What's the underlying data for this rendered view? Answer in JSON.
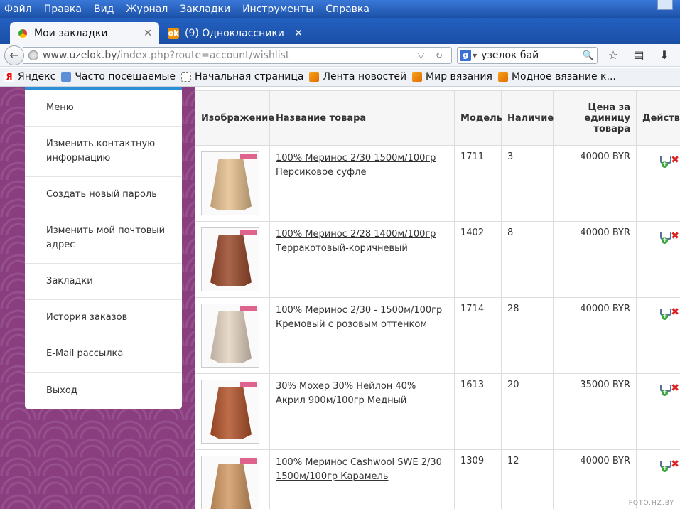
{
  "menubar": {
    "items": [
      "Файл",
      "Правка",
      "Вид",
      "Журнал",
      "Закладки",
      "Инструменты",
      "Справка"
    ]
  },
  "tabs": [
    {
      "label": "Мои закладки",
      "icon": "site-favicon",
      "active": true
    },
    {
      "label": "(9) Одноклассники",
      "icon": "odnoklassniki-favicon",
      "active": false
    }
  ],
  "urlbar": {
    "host": "www.uzelok.by",
    "path": "/index.php?route=account/wishlist"
  },
  "search": {
    "engine": "g",
    "query": "узелок бай"
  },
  "bookmarks": [
    {
      "label": "Яндекс",
      "icon": "yandex-icon"
    },
    {
      "label": "Часто посещаемые",
      "icon": "frequent-icon"
    },
    {
      "label": "Начальная страница",
      "icon": "home-page-icon"
    },
    {
      "label": "Лента новостей",
      "icon": "rss-icon"
    },
    {
      "label": "Мир вязания",
      "icon": "rss-icon"
    },
    {
      "label": "Модное вязание к...",
      "icon": "rss-icon"
    }
  ],
  "sidemenu": {
    "items": [
      "Меню",
      "Изменить контактную информацию",
      "Создать новый пароль",
      "Изменить мой почтовый адрес",
      "Закладки",
      "История заказов",
      "E-Mail рассылка",
      "Выход"
    ]
  },
  "wishlist": {
    "headers": {
      "image": "Изображение",
      "name": "Название товара",
      "model": "Модель",
      "stock": "Наличие",
      "price": "Цена за единицу товара",
      "action": "Действие"
    },
    "rows": [
      {
        "name": "100% Меринос 2/30 1500м/100гр Персиковое суфле",
        "model": "1711",
        "stock": "3",
        "price": "40000 BYR",
        "color": "#e6c08f"
      },
      {
        "name": "100% Меринос 2/28 1400м/100гр Терракотовый-коричневый",
        "model": "1402",
        "stock": "8",
        "price": "40000 BYR",
        "color": "#9a4a2c"
      },
      {
        "name": "100% Меринос 2/30 - 1500м/100гр Кремовый с розовым оттенком",
        "model": "1714",
        "stock": "28",
        "price": "40000 BYR",
        "color": "#e4d4c2"
      },
      {
        "name": "30% Мохер 30% Нейлон 40% Акрил 900м/100гр Медный",
        "model": "1613",
        "stock": "20",
        "price": "35000 BYR",
        "color": "#b2542b"
      },
      {
        "name": "100% Меринос Cashwool SWE 2/30 1500м/100гр Карамель",
        "model": "1309",
        "stock": "12",
        "price": "40000 BYR",
        "color": "#d29a64"
      }
    ]
  },
  "watermark": "FOTO.HZ.BY"
}
